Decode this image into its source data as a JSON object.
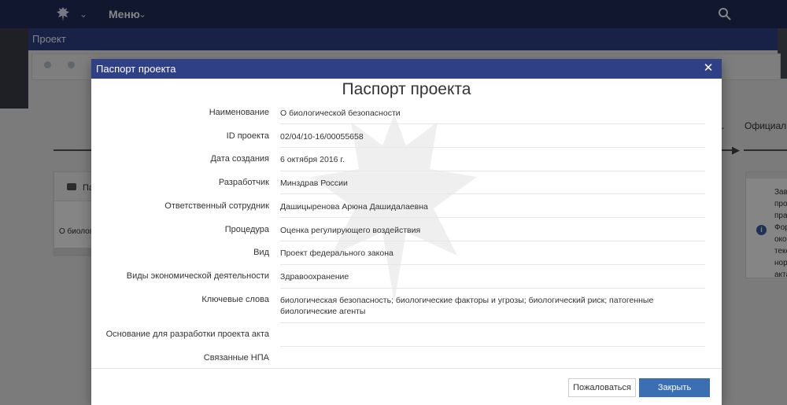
{
  "topbar": {
    "menu_label": "Меню",
    "emblem_icon": "emblem-icon",
    "search_icon": "search-icon"
  },
  "subbar": {
    "title": "Проект"
  },
  "background": {
    "official_label": "Официаль",
    "dash": "_",
    "left_card_header": "Па",
    "left_card_row": "О биологи",
    "right_card_text": [
      "Зав",
      "про",
      "пра",
      "Фор",
      "око",
      "текс",
      "норм",
      "акта"
    ]
  },
  "modal": {
    "header_title": "Паспорт проекта",
    "close_symbol": "✕",
    "doc_title": "Паспорт проекта",
    "fields": [
      {
        "label": "Наименование",
        "value": "О биологической безопасности"
      },
      {
        "label": "ID проекта",
        "value": "02/04/10-16/00055658"
      },
      {
        "label": "Дата создания",
        "value": "6 октября 2016 г."
      },
      {
        "label": "Разработчик",
        "value": "Минздрав России"
      },
      {
        "label": "Ответственный сотрудник",
        "value": "Дашицыренова Арюна Дашидалаевна"
      },
      {
        "label": "Процедура",
        "value": "Оценка регулирующего воздействия"
      },
      {
        "label": "Вид",
        "value": "Проект федерального закона"
      },
      {
        "label": "Виды экономической деятельности",
        "value": "Здравоохранение"
      },
      {
        "label": "Ключевые слова",
        "value": "биологическая безопасность; биологические факторы и угрозы; биологический риск; патогенные биологические агенты"
      },
      {
        "label": "Основание для разработки проекта акта",
        "value": ""
      },
      {
        "label": "Связанные НПА",
        "value": ""
      }
    ],
    "complain_button": "Пожаловаться",
    "close_button": "Закрыть"
  },
  "colors": {
    "nav": "#1f2d5a",
    "header": "#2f4087",
    "primary_button": "#3a6fb3"
  }
}
